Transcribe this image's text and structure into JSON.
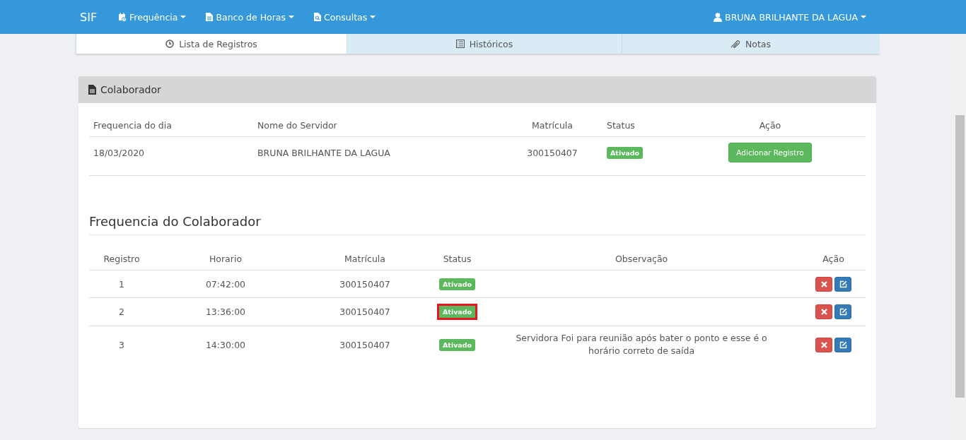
{
  "navbar": {
    "brand": "SIF",
    "menus": [
      {
        "label": "Frequência",
        "kind": "calendar"
      },
      {
        "label": "Banco de Horas",
        "kind": "document"
      },
      {
        "label": "Consultas",
        "kind": "lookup"
      }
    ],
    "user": "BRUNA BRILHANTE DA LAGUA"
  },
  "tabs": [
    {
      "label": "Lista de Registros",
      "kind": "clock",
      "selected": true
    },
    {
      "label": "Históricos",
      "kind": "list",
      "selected": false
    },
    {
      "label": "Notas",
      "kind": "attachment",
      "selected": false
    }
  ],
  "panel": {
    "title": "Colaborador",
    "summary": {
      "columns": [
        "Frequencia do dia",
        "Nome do Servidor",
        "Matrícula",
        "Status",
        "Ação"
      ],
      "row": {
        "date": "18/03/2020",
        "name": "BRUNA BRILHANTE DA LAGUA",
        "matricula": "300150407",
        "status": "Ativado",
        "action": "Adicionar Registro"
      }
    },
    "section_title": "Frequencia do Colaborador",
    "records": {
      "columns": [
        "Registro",
        "Horario",
        "Matrícula",
        "Status",
        "Observação",
        "Ação"
      ],
      "rows": [
        {
          "registro": "1",
          "horario": "07:42:00",
          "matricula": "300150407",
          "status": "Ativado",
          "observacao": "",
          "highlighted": false
        },
        {
          "registro": "2",
          "horario": "13:36:00",
          "matricula": "300150407",
          "status": "Ativado",
          "observacao": "",
          "highlighted": true
        },
        {
          "registro": "3",
          "horario": "14:30:00",
          "matricula": "300150407",
          "status": "Ativado",
          "observacao": "Servidora Foi para reunião após bater o ponto e esse é o horário correto de saída",
          "highlighted": false
        }
      ]
    }
  }
}
